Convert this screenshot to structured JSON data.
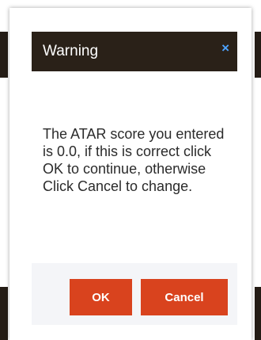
{
  "dialog": {
    "title": "Warning",
    "close_glyph": "×",
    "message": "The ATAR score you entered is 0.0, if this is correct click OK to continue, otherwise Click Cancel to change.",
    "ok_label": "OK",
    "cancel_label": "Cancel"
  },
  "colors": {
    "header_bg": "#2a2118",
    "close_icon": "#4da3ff",
    "button_bg": "#d9431e",
    "footer_bg": "#f4f5f8"
  }
}
